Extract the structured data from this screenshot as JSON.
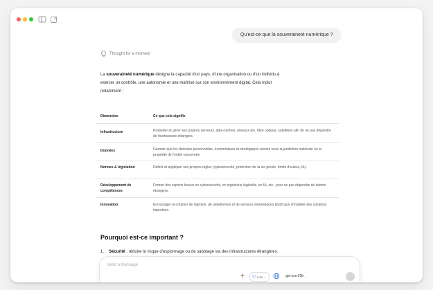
{
  "user_message": "Qu'est-ce que la souveraineté numérique ?",
  "thought_status": "Thought for a moment",
  "intro": {
    "bold_term": "souveraineté numérique",
    "prefix": "La ",
    "rest_line1": " désigne la capacité d'un pays, d'une organisation ou d'un individu à",
    "line2": "exercer un contrôle, une autonomie et une maîtrise sur son environnement digital. Cela inclut",
    "line3": "notamment :"
  },
  "table": {
    "headers": [
      "Dimension",
      "Ce que cela signifie"
    ],
    "rows": [
      {
        "dimension": "Infrastructure",
        "meaning": "Posséder et gérer ses propres serveurs, data-centres, réseaux (ex. fibre optique, satellites) afin de ne pas dépendre de fournisseurs étrangers."
      },
      {
        "dimension": "Données",
        "meaning": "Garantir que les données personnelles, économiques et stratégiques restent sous la juridiction nationale ou la propriété de l'entité concernée."
      },
      {
        "dimension": "Normes & législation",
        "meaning": "Définir et appliquer ses propres règles (cybersécurité, protection de la vie privée, droits d'auteur, IA)."
      },
      {
        "dimension": "Développement de compétences",
        "meaning": "Former des experts locaux en cybersécurité, en ingénierie logicielle, en IA, etc., pour ne pas dépendre de talents étrangers."
      },
      {
        "dimension": "Innovation",
        "meaning": "Encourager la création de logiciels, de plateformes et de services domestiques plutôt que d'installer des solutions importées."
      }
    ]
  },
  "section_title": "Pourquoi est-ce important ?",
  "list": [
    {
      "number": "1.",
      "title": "Sécurité",
      "text": " : réduire le risque d'espionnage ou de sabotage via des infrastructures étrangères."
    }
  ],
  "composer": {
    "placeholder": "Send a message",
    "reasoning_label": "Low",
    "model_name": "gpt-oss:20b"
  },
  "icons": {
    "sidebar": "sidebar-toggle-icon",
    "newchat": "new-chat-icon",
    "thought": "lightbulb-icon",
    "plus": "plus-icon",
    "globe": "globe-icon",
    "send": "send-icon"
  }
}
